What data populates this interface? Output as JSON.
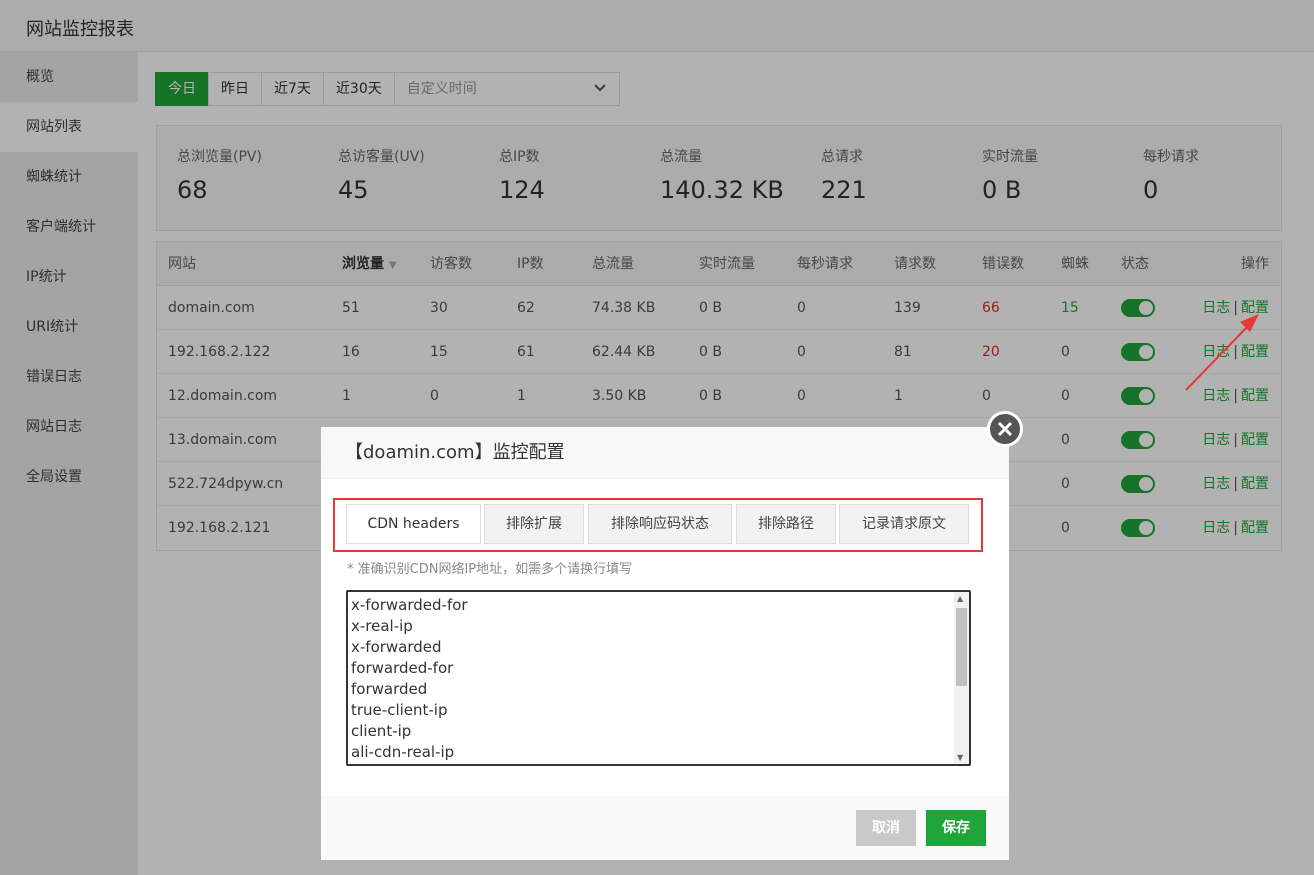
{
  "app": {
    "title": "网站监控报表"
  },
  "sidebar": {
    "items": [
      {
        "label": "概览"
      },
      {
        "label": "网站列表"
      },
      {
        "label": "蜘蛛统计"
      },
      {
        "label": "客户端统计"
      },
      {
        "label": "IP统计"
      },
      {
        "label": "URI统计"
      },
      {
        "label": "错误日志"
      },
      {
        "label": "网站日志"
      },
      {
        "label": "全局设置"
      }
    ]
  },
  "datebar": {
    "buttons": [
      "今日",
      "昨日",
      "近7天",
      "近30天"
    ],
    "custom_placeholder": "自定义时间"
  },
  "stats": [
    {
      "label": "总浏览量(PV)",
      "value": "68"
    },
    {
      "label": "总访客量(UV)",
      "value": "45"
    },
    {
      "label": "总IP数",
      "value": "124"
    },
    {
      "label": "总流量",
      "value": "140.32 KB"
    },
    {
      "label": "总请求",
      "value": "221"
    },
    {
      "label": "实时流量",
      "value": "0 B"
    },
    {
      "label": "每秒请求",
      "value": "0"
    }
  ],
  "table": {
    "headers": [
      "网站",
      "浏览量",
      "访客数",
      "IP数",
      "总流量",
      "实时流量",
      "每秒请求",
      "请求数",
      "错误数",
      "蜘蛛",
      "状态",
      "操作"
    ],
    "op_log": "日志",
    "op_sep": "|",
    "op_config": "配置",
    "rows": [
      [
        "domain.com",
        "51",
        "30",
        "62",
        "74.38 KB",
        "0 B",
        "0",
        "139",
        "66",
        "15"
      ],
      [
        "192.168.2.122",
        "16",
        "15",
        "61",
        "62.44 KB",
        "0 B",
        "0",
        "81",
        "20",
        "0"
      ],
      [
        "12.domain.com",
        "1",
        "0",
        "1",
        "3.50 KB",
        "0 B",
        "0",
        "1",
        "0",
        "0"
      ],
      [
        "13.domain.com",
        "",
        "",
        "",
        "",
        "",
        "",
        "",
        "",
        "0"
      ],
      [
        "522.724dpyw.cn",
        "",
        "",
        "",
        "",
        "",
        "",
        "",
        "",
        "0"
      ],
      [
        "192.168.2.121",
        "",
        "",
        "",
        "",
        "",
        "",
        "",
        "",
        "0"
      ]
    ]
  },
  "modal": {
    "title": "【doamin.com】监控配置",
    "tabs": [
      "CDN headers",
      "排除扩展",
      "排除响应码状态",
      "排除路径",
      "记录请求原文"
    ],
    "hint": "* 准确识别CDN网络IP地址，如需多个请换行填写",
    "headers_lines": [
      "x-forwarded-for",
      "x-real-ip",
      "x-forwarded",
      "forwarded-for",
      "forwarded",
      "true-client-ip",
      "client-ip",
      "ali-cdn-real-ip"
    ],
    "cancel_label": "取消",
    "save_label": "保存"
  },
  "colors": {
    "accent": "#20a53a",
    "error": "#e22222",
    "highlight": "#e53935"
  }
}
